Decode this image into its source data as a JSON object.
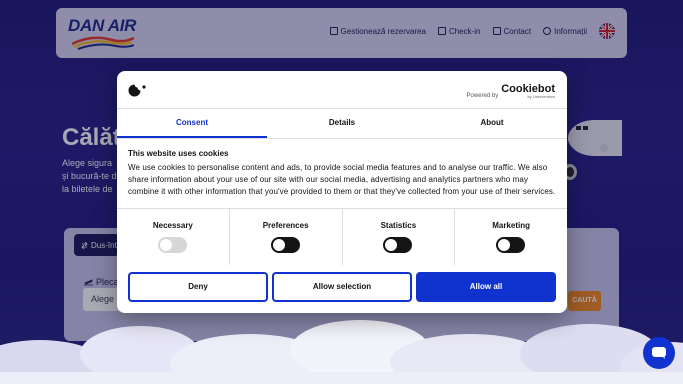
{
  "header": {
    "logo_text": "DAN AIR",
    "nav": [
      {
        "label": "Gestionează rezervarea",
        "icon": "edit-icon"
      },
      {
        "label": "Check-in",
        "icon": "ticket-icon"
      },
      {
        "label": "Contact",
        "icon": "mail-icon"
      },
      {
        "label": "Informații",
        "icon": "info-icon"
      }
    ],
    "language_icon": "uk-flag-icon"
  },
  "hero": {
    "title": "Călăt",
    "subtitle_lines": [
      "Alege sigura",
      "și bucură-te d",
      "la biletele de"
    ]
  },
  "search": {
    "trip_type": "Dus-înt",
    "from_label": "Plecar",
    "from_value": "Alege a",
    "search_button": "CAUTĂ"
  },
  "cookie_banner": {
    "powered_by": "Powered by",
    "brand": "Cookiebot",
    "brand_sub": "by Usercentrics",
    "tabs": [
      "Consent",
      "Details",
      "About"
    ],
    "active_tab": "Consent",
    "heading": "This website uses cookies",
    "body": "We use cookies to personalise content and ads, to provide social media features and to analyse our traffic. We also share information about your use of our site with our social media, advertising and analytics partners who may combine it with other information that you've provided to them or that they've collected from your use of their services.",
    "categories": [
      {
        "label": "Necessary",
        "enabled": false,
        "locked": true
      },
      {
        "label": "Preferences",
        "enabled": false,
        "locked": false
      },
      {
        "label": "Statistics",
        "enabled": false,
        "locked": false
      },
      {
        "label": "Marketing",
        "enabled": false,
        "locked": false
      }
    ],
    "buttons": {
      "deny": "Deny",
      "allow_selection": "Allow selection",
      "allow_all": "Allow all"
    }
  },
  "colors": {
    "accent_blue": "#1032cf",
    "search_orange": "#f08a24",
    "hero_navy": "#231d78"
  },
  "chat": {
    "icon": "chat-icon"
  }
}
